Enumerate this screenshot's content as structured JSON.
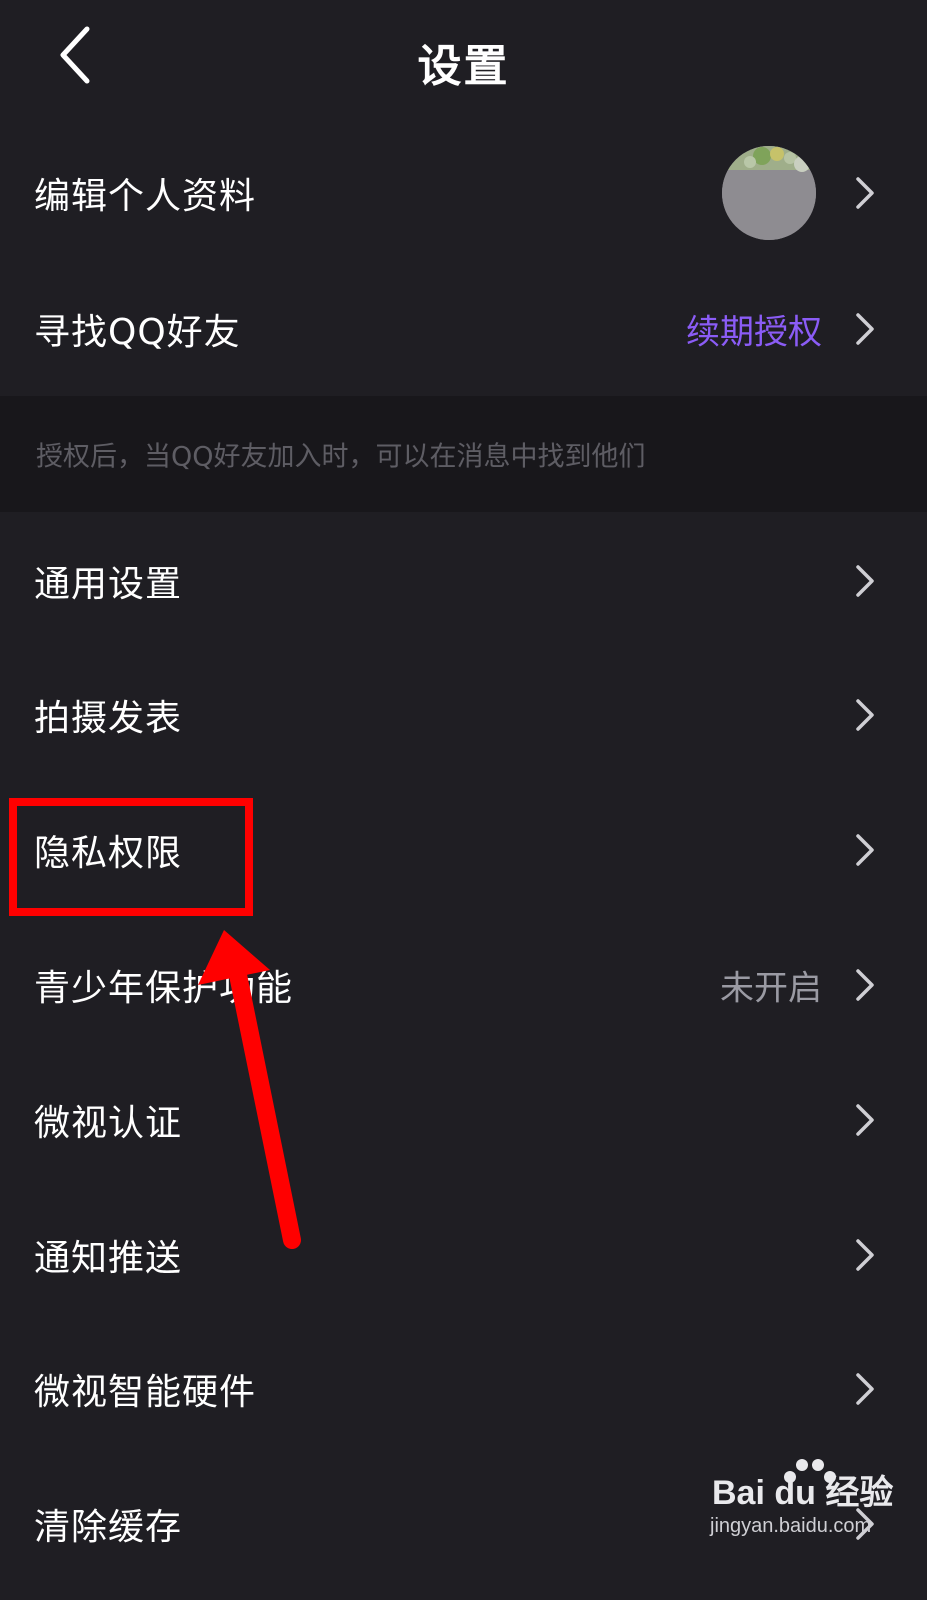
{
  "header": {
    "title": "设置"
  },
  "rows": {
    "edit_profile": {
      "label": "编辑个人资料"
    },
    "find_qq": {
      "label": "寻找QQ好友",
      "value": "续期授权"
    },
    "hint": "授权后，当QQ好友加入时，可以在消息中找到他们",
    "general": {
      "label": "通用设置"
    },
    "shoot_publish": {
      "label": "拍摄发表"
    },
    "privacy": {
      "label": "隐私权限"
    },
    "teen_mode": {
      "label": "青少年保护功能",
      "value": "未开启"
    },
    "certification": {
      "label": "微视认证"
    },
    "notifications": {
      "label": "通知推送"
    },
    "smart_hardware": {
      "label": "微视智能硬件"
    },
    "clear_cache": {
      "label": "清除缓存"
    }
  },
  "watermark": {
    "logo": "Bai du 经验",
    "url": "jingyan.baidu.com"
  },
  "colors": {
    "background": "#1f1e23",
    "accent": "#8b5cf6",
    "annotation": "#ff0000"
  },
  "icons": {
    "back": "back-arrow-icon",
    "chevron": "chevron-right-icon"
  }
}
